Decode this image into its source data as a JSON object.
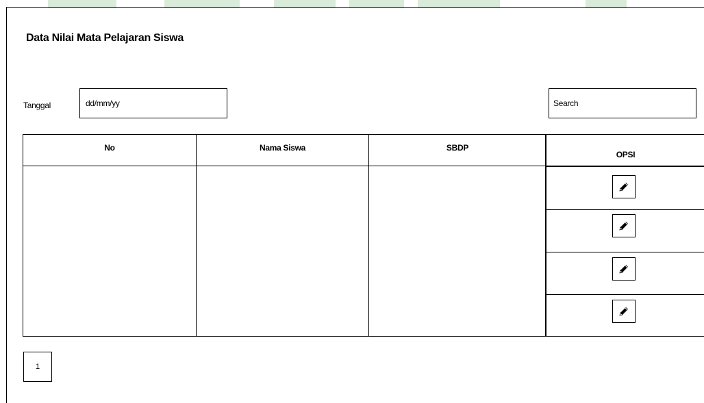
{
  "page": {
    "title": "Data Nilai Mata Pelajaran Siswa"
  },
  "filter": {
    "date_label": "Tanggal",
    "date_value": "dd/mm/yy",
    "search_value": "Search"
  },
  "table": {
    "columns": [
      "No",
      "Nama Siswa",
      "SBDP",
      "OPSI"
    ],
    "rows": [
      {
        "no": "",
        "nama_siswa": "",
        "sbdp": "",
        "action_icon": "pencil-icon"
      },
      {
        "no": "",
        "nama_siswa": "",
        "sbdp": "",
        "action_icon": "pencil-icon"
      },
      {
        "no": "",
        "nama_siswa": "",
        "sbdp": "",
        "action_icon": "pencil-icon"
      },
      {
        "no": "",
        "nama_siswa": "",
        "sbdp": "",
        "action_icon": "pencil-icon"
      }
    ]
  },
  "pagination": {
    "current_page": "1"
  },
  "colors": {
    "border": "#000000",
    "watermark": "#d8ecd9"
  }
}
